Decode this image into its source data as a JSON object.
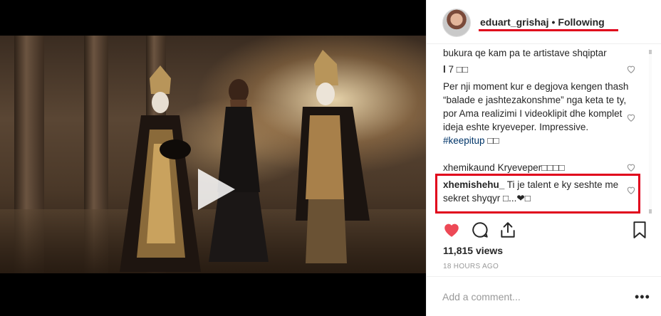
{
  "post": {
    "username": "eduart_grishaj",
    "separator": "•",
    "follow_status": "Following"
  },
  "comments": [
    {
      "text": "bukura qe kam pa te artistave shqiptar"
    },
    {
      "user": "l",
      "text": "7 □□"
    },
    {
      "user": "",
      "text": "Per nji moment kur e degjova kengen thash “balade e jashtezakonshme” nga keta te ty, por Ama realizimi I videoklipit dhe komplet ideja eshte kryeveper. Impressive.",
      "hashtag": "#keepitup",
      "suffix": "□□"
    },
    {
      "user": "xhemikaund",
      "text": "Kryeveper□□□□"
    },
    {
      "user": "xhemishehu_",
      "text": "Ti je talent e ky seshte me sekret shyqyr □...❤□"
    }
  ],
  "stats": {
    "views": "11,815 views",
    "time_ago": "18 HOURS AGO"
  },
  "composer": {
    "placeholder": "Add a comment...",
    "more": "•••"
  },
  "colors": {
    "highlight": "#e0001b",
    "like": "#ed4956"
  }
}
